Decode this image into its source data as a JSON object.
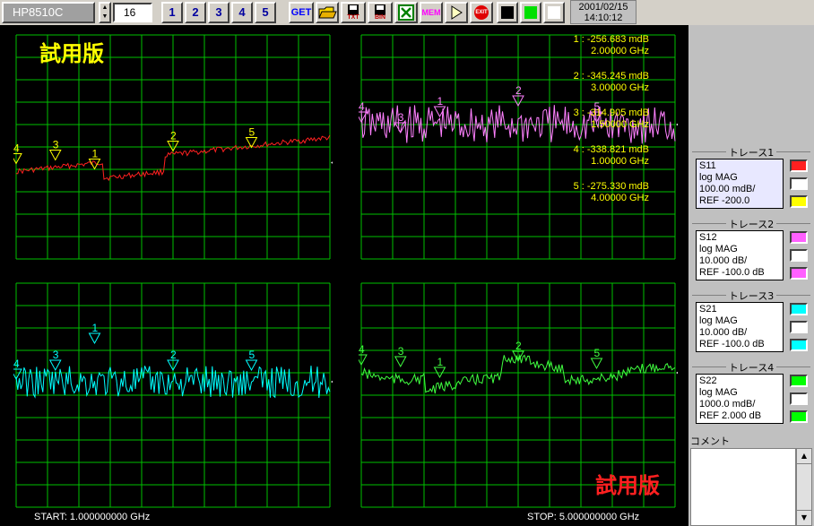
{
  "toolbar": {
    "model": "HP8510C",
    "averaging": "16",
    "channels": [
      "1",
      "2",
      "3",
      "4",
      "5"
    ],
    "get": "GET",
    "txt": "TXT",
    "bin": "BIN",
    "mem": "MEM",
    "exit": "EXIT",
    "date": "2001/02/15",
    "time": "14:10:12",
    "color_buttons": [
      "#000000",
      "#00c000",
      "#ffffff"
    ]
  },
  "screen": {
    "watermark_top": "試用版",
    "watermark_bottom": "試用版",
    "start": "START: 1.000000000 GHz",
    "stop": "STOP: 5.000000000 GHz",
    "marker_readouts": [
      {
        "id": "1 :",
        "value": "-256.683 mdB",
        "freq": "2.00000 GHz"
      },
      {
        "id": "2 :",
        "value": "-345.245 mdB",
        "freq": "3.00000 GHz"
      },
      {
        "id": "3 :",
        "value": "-314.905 mdB",
        "freq": "1.50000 GHz"
      },
      {
        "id": "4 :",
        "value": "-338.821 mdB",
        "freq": "1.00000 GHz"
      },
      {
        "id": "5 :",
        "value": "-275.330 mdB",
        "freq": "4.00000 GHz"
      }
    ]
  },
  "plots": [
    {
      "param": "S11",
      "color": "#ff2020",
      "markers": [
        {
          "n": "1",
          "f": 2.0
        },
        {
          "n": "2",
          "f": 3.0
        },
        {
          "n": "3",
          "f": 1.5
        },
        {
          "n": "4",
          "f": 1.0
        },
        {
          "n": "5",
          "f": 4.0
        }
      ]
    },
    {
      "param": "S12",
      "color": "#ff80ff",
      "markers": [
        {
          "n": "1",
          "f": 2.0
        },
        {
          "n": "2",
          "f": 3.0
        },
        {
          "n": "3",
          "f": 1.5
        },
        {
          "n": "4",
          "f": 1.0
        },
        {
          "n": "5",
          "f": 4.0
        }
      ]
    },
    {
      "param": "S21",
      "color": "#00ffff",
      "markers": [
        {
          "n": "1",
          "f": 2.0
        },
        {
          "n": "2",
          "f": 3.0
        },
        {
          "n": "3",
          "f": 1.5
        },
        {
          "n": "4",
          "f": 1.0
        },
        {
          "n": "5",
          "f": 4.0
        }
      ]
    },
    {
      "param": "S22",
      "color": "#40ff40",
      "markers": [
        {
          "n": "1",
          "f": 2.0
        },
        {
          "n": "2",
          "f": 3.0
        },
        {
          "n": "3",
          "f": 1.5
        },
        {
          "n": "4",
          "f": 1.0
        },
        {
          "n": "5",
          "f": 4.0
        }
      ]
    }
  ],
  "traces": [
    {
      "title": "トレース1",
      "lines": [
        "S11",
        "log MAG",
        "100.00 mdB/",
        "REF -200.0"
      ],
      "colors": [
        "#ff2020",
        "#ffffff",
        "#ffff00"
      ]
    },
    {
      "title": "トレース2",
      "lines": [
        "S12",
        "log MAG",
        "10.000 dB/",
        "REF -100.0 dB"
      ],
      "colors": [
        "#ff60ff",
        "#ffffff",
        "#ff60ff"
      ]
    },
    {
      "title": "トレース3",
      "lines": [
        "S21",
        "log MAG",
        "10.000 dB/",
        "REF -100.0 dB"
      ],
      "colors": [
        "#00ffff",
        "#ffffff",
        "#00ffff"
      ]
    },
    {
      "title": "トレース4",
      "lines": [
        "S22",
        "log MAG",
        "1000.0 mdB/",
        "REF 2.000 dB"
      ],
      "colors": [
        "#00ff00",
        "#ffffff",
        "#00ff00"
      ]
    }
  ],
  "comment": {
    "label": "コメント"
  },
  "colors": {
    "grid": "#00c000",
    "screen": "#000000",
    "marker_text": "#ffff00",
    "watermark_top": "#ffff00",
    "watermark_bottom": "#ff2020"
  }
}
